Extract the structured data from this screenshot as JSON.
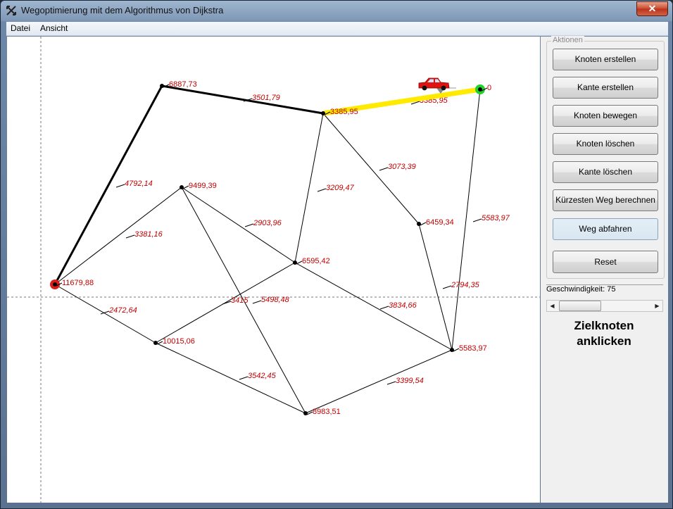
{
  "window": {
    "title": "Wegoptimierung mit dem Algorithmus von Dijkstra",
    "close_label": "✕"
  },
  "menu": [
    {
      "id": "datei",
      "label": "Datei"
    },
    {
      "id": "ansicht",
      "label": "Ansicht"
    }
  ],
  "actions": {
    "group_label": "Aktionen",
    "buttons": [
      {
        "id": "create-node",
        "label": "Knoten erstellen"
      },
      {
        "id": "create-edge",
        "label": "Kante erstellen"
      },
      {
        "id": "move-node",
        "label": "Knoten bewegen"
      },
      {
        "id": "delete-node",
        "label": "Knoten löschen"
      },
      {
        "id": "delete-edge",
        "label": "Kante löschen"
      },
      {
        "id": "compute-shortest-path",
        "label": "Kürzesten Weg berechnen"
      },
      {
        "id": "drive-path",
        "label": "Weg abfahren"
      },
      {
        "id": "reset",
        "label": "Reset"
      }
    ]
  },
  "speed": {
    "label": "Geschwindigkeit: 75",
    "value": 75
  },
  "hint": {
    "line1": "Zielknoten",
    "line2": "anklicken"
  },
  "graph": {
    "nodes": [
      {
        "id": "n1",
        "label": "6887,73"
      },
      {
        "id": "n2",
        "label": "3385,95"
      },
      {
        "id": "n3",
        "label": "0"
      },
      {
        "id": "n4",
        "label": "9499,39"
      },
      {
        "id": "n5",
        "label": "6459,34"
      },
      {
        "id": "n6",
        "label": "6595,42"
      },
      {
        "id": "n7",
        "label": "11679,88"
      },
      {
        "id": "n8",
        "label": "10015,06"
      },
      {
        "id": "n9",
        "label": "5583,97"
      },
      {
        "id": "n10",
        "label": "8983,51"
      }
    ],
    "edges": [
      {
        "id": "e1",
        "from": "n1",
        "to": "n2",
        "label": "3501,79"
      },
      {
        "id": "e2",
        "from": "n2",
        "to": "n3",
        "label": "3385,95"
      },
      {
        "id": "e3",
        "from": "n1",
        "to": "n7",
        "label": "4792,14"
      },
      {
        "id": "e4",
        "from": "n2",
        "to": "n6",
        "label": "3209,47"
      },
      {
        "id": "e5",
        "from": "n2",
        "to": "n5",
        "label": "3073,39"
      },
      {
        "id": "e6",
        "from": "n3",
        "to": "n9",
        "label": "5583,97"
      },
      {
        "id": "e7",
        "from": "n4",
        "to": "n7",
        "label": "3381,16"
      },
      {
        "id": "e8",
        "from": "n4",
        "to": "n6",
        "label": "2903,96"
      },
      {
        "id": "e9",
        "from": "n4",
        "to": "n10",
        "label": "5498,48"
      },
      {
        "id": "e10",
        "from": "n6",
        "to": "n8",
        "label": "3415"
      },
      {
        "id": "e11",
        "from": "n6",
        "to": "n9",
        "label": "3834,66"
      },
      {
        "id": "e12",
        "from": "n5",
        "to": "n9",
        "label": "2794,35"
      },
      {
        "id": "e13",
        "from": "n7",
        "to": "n8",
        "label": "2472,64"
      },
      {
        "id": "e14",
        "from": "n8",
        "to": "n10",
        "label": "3542,45"
      },
      {
        "id": "e15",
        "from": "n10",
        "to": "n9",
        "label": "3399,54"
      }
    ],
    "start_node": "n7",
    "target_node": "n3",
    "colors": {
      "start": "#e01b1b",
      "target": "#22d22a",
      "label": "#c00000",
      "path_highlight": "#ffea00",
      "car": "#e01212"
    }
  }
}
